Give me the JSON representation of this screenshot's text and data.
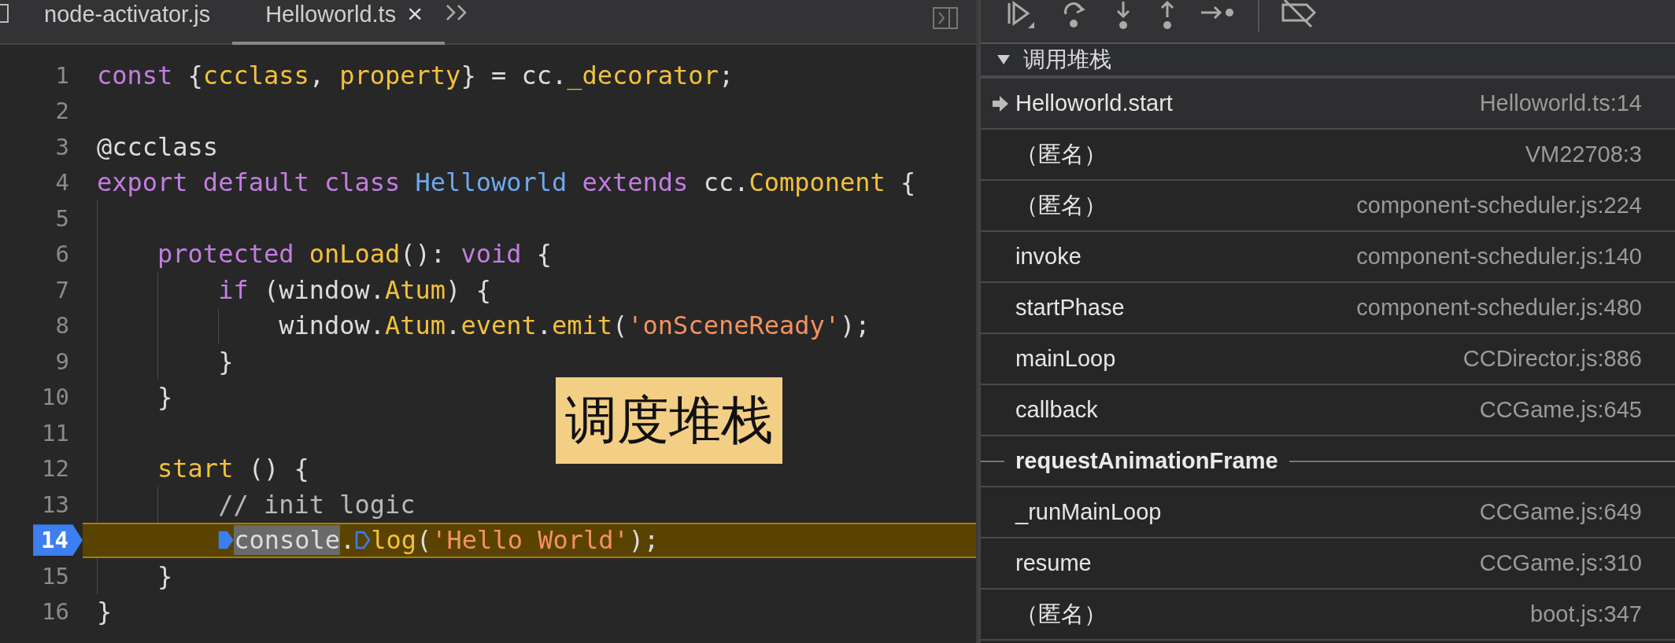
{
  "editor": {
    "tabs": [
      {
        "label": "node-activator.js",
        "selected": false,
        "closable": false
      },
      {
        "label": "Helloworld.ts",
        "selected": true,
        "closable": true
      }
    ],
    "close_glyph": "×",
    "lines": [
      {
        "number": "1",
        "current": false,
        "tokens": [
          {
            "kind": "kw",
            "text": "const "
          },
          {
            "kind": "plain",
            "text": "{"
          },
          {
            "kind": "fn",
            "text": "ccclass"
          },
          {
            "kind": "plain",
            "text": ", "
          },
          {
            "kind": "fn",
            "text": "property"
          },
          {
            "kind": "plain",
            "text": "} = cc."
          },
          {
            "kind": "fn",
            "text": "_decorator"
          },
          {
            "kind": "plain",
            "text": ";"
          }
        ]
      },
      {
        "number": "2",
        "current": false
      },
      {
        "number": "3",
        "current": false,
        "tokens": [
          {
            "kind": "plain",
            "text": "@ccclass"
          }
        ]
      },
      {
        "number": "4",
        "current": false,
        "tokens": [
          {
            "kind": "kw",
            "text": "export default class "
          },
          {
            "kind": "cls",
            "text": "Helloworld"
          },
          {
            "kind": "kw",
            "text": " extends "
          },
          {
            "kind": "plain",
            "text": "cc."
          },
          {
            "kind": "fn",
            "text": "Component"
          },
          {
            "kind": "plain",
            "text": " {"
          }
        ],
        "children": [
          {
            "number": "5",
            "current": false
          },
          {
            "number": "6",
            "current": false,
            "tokens": [
              {
                "kind": "kw",
                "text": "protected "
              },
              {
                "kind": "fn",
                "text": "onLoad"
              },
              {
                "kind": "plain",
                "text": "(): "
              },
              {
                "kind": "kw",
                "text": "void"
              },
              {
                "kind": "plain",
                "text": " {"
              }
            ],
            "children": [
              {
                "number": "7",
                "current": false,
                "tokens": [
                  {
                    "kind": "kw",
                    "text": "if "
                  },
                  {
                    "kind": "plain",
                    "text": "(window."
                  },
                  {
                    "kind": "fn",
                    "text": "Atum"
                  },
                  {
                    "kind": "plain",
                    "text": ") {"
                  }
                ],
                "children": [
                  {
                    "number": "8",
                    "current": false,
                    "tokens": [
                      {
                        "kind": "plain",
                        "text": "window."
                      },
                      {
                        "kind": "fn",
                        "text": "Atum"
                      },
                      {
                        "kind": "plain",
                        "text": "."
                      },
                      {
                        "kind": "fn",
                        "text": "event"
                      },
                      {
                        "kind": "plain",
                        "text": "."
                      },
                      {
                        "kind": "fn",
                        "text": "emit"
                      },
                      {
                        "kind": "plain",
                        "text": "("
                      },
                      {
                        "kind": "str",
                        "text": "'onSceneReady'"
                      },
                      {
                        "kind": "plain",
                        "text": ");"
                      }
                    ]
                  }
                ]
              },
              {
                "number": "9",
                "current": false,
                "tokens": [
                  {
                    "kind": "plain",
                    "text": "}"
                  }
                ]
              }
            ]
          },
          {
            "number": "10",
            "current": false,
            "tokens": [
              {
                "kind": "plain",
                "text": "}"
              }
            ]
          },
          {
            "number": "11",
            "current": false
          },
          {
            "number": "12",
            "current": false,
            "tokens": [
              {
                "kind": "fn",
                "text": "start"
              },
              {
                "kind": "plain",
                "text": " () {"
              }
            ],
            "children": [
              {
                "number": "13",
                "current": false,
                "tokens": [
                  {
                    "kind": "comment",
                    "text": "// init logic"
                  }
                ]
              },
              {
                "number": "14",
                "current": true,
                "tokens": [
                  {
                    "kind": "marker"
                  },
                  {
                    "kind": "selection",
                    "text": "console"
                  },
                  {
                    "kind": "plain",
                    "text": "."
                  },
                  {
                    "kind": "marker"
                  },
                  {
                    "kind": "fn",
                    "text": "log"
                  },
                  {
                    "kind": "plain",
                    "text": "("
                  },
                  {
                    "kind": "str",
                    "text": "'Hello World'"
                  },
                  {
                    "kind": "plain",
                    "text": ");"
                  }
                ]
              }
            ]
          },
          {
            "number": "15",
            "current": false,
            "tokens": [
              {
                "kind": "plain",
                "text": "}"
              }
            ]
          }
        ]
      },
      {
        "number": "16",
        "current": false,
        "tokens": [
          {
            "kind": "plain",
            "text": "}"
          }
        ]
      }
    ],
    "overlay_label": "调度堆栈"
  },
  "call_stack": {
    "title": "调用堆栈",
    "expanded": true,
    "frames": [
      {
        "kind": "frame",
        "name": "Helloworld.start",
        "location": "Helloworld.ts:14",
        "current": true
      },
      {
        "kind": "frame",
        "name": "（匿名）",
        "location": "VM22708:3",
        "current": false
      },
      {
        "kind": "frame",
        "name": "（匿名）",
        "location": "component-scheduler.js:224",
        "current": false
      },
      {
        "kind": "frame",
        "name": "invoke",
        "location": "component-scheduler.js:140",
        "current": false
      },
      {
        "kind": "frame",
        "name": "startPhase",
        "location": "component-scheduler.js:480",
        "current": false
      },
      {
        "kind": "frame",
        "name": "mainLoop",
        "location": "CCDirector.js:886",
        "current": false
      },
      {
        "kind": "frame",
        "name": "callback",
        "location": "CCGame.js:645",
        "current": false
      },
      {
        "kind": "async",
        "name": "requestAnimationFrame",
        "current": false
      },
      {
        "kind": "frame",
        "name": "_runMainLoop",
        "location": "CCGame.js:649",
        "current": false
      },
      {
        "kind": "frame",
        "name": "resume",
        "location": "CCGame.js:310",
        "current": false
      },
      {
        "kind": "frame",
        "name": "（匿名）",
        "location": "boot.js:347",
        "current": false
      }
    ]
  }
}
